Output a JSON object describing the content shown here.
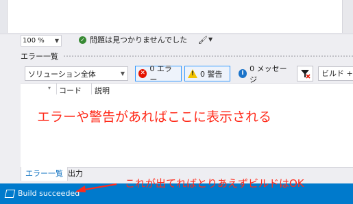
{
  "editor": {
    "zoom": "100 %",
    "issues_text": "問題は見つかりませんでした"
  },
  "error_list": {
    "title": "エラー一覧",
    "scope": "ソリューション全体",
    "errors_label": "0 エラー",
    "warnings_label": "0 警告",
    "messages_label": "0 メッセージ",
    "build_scope": "ビルド + I",
    "columns": [
      "コード",
      "説明"
    ]
  },
  "tabs": [
    "エラー一覧",
    "出力"
  ],
  "status_bar": {
    "text": "Build succeeded"
  },
  "annotations": {
    "note_errors": "エラーや警告があればここに表示される",
    "note_build": "これが出てればとりあえずビルドはOK",
    "color": "#ff2a1a"
  },
  "colors": {
    "status_bar": "#007acc",
    "error": "#e51400",
    "warning": "#f2c300",
    "info": "#1b73c9",
    "ok": "#388a34"
  }
}
